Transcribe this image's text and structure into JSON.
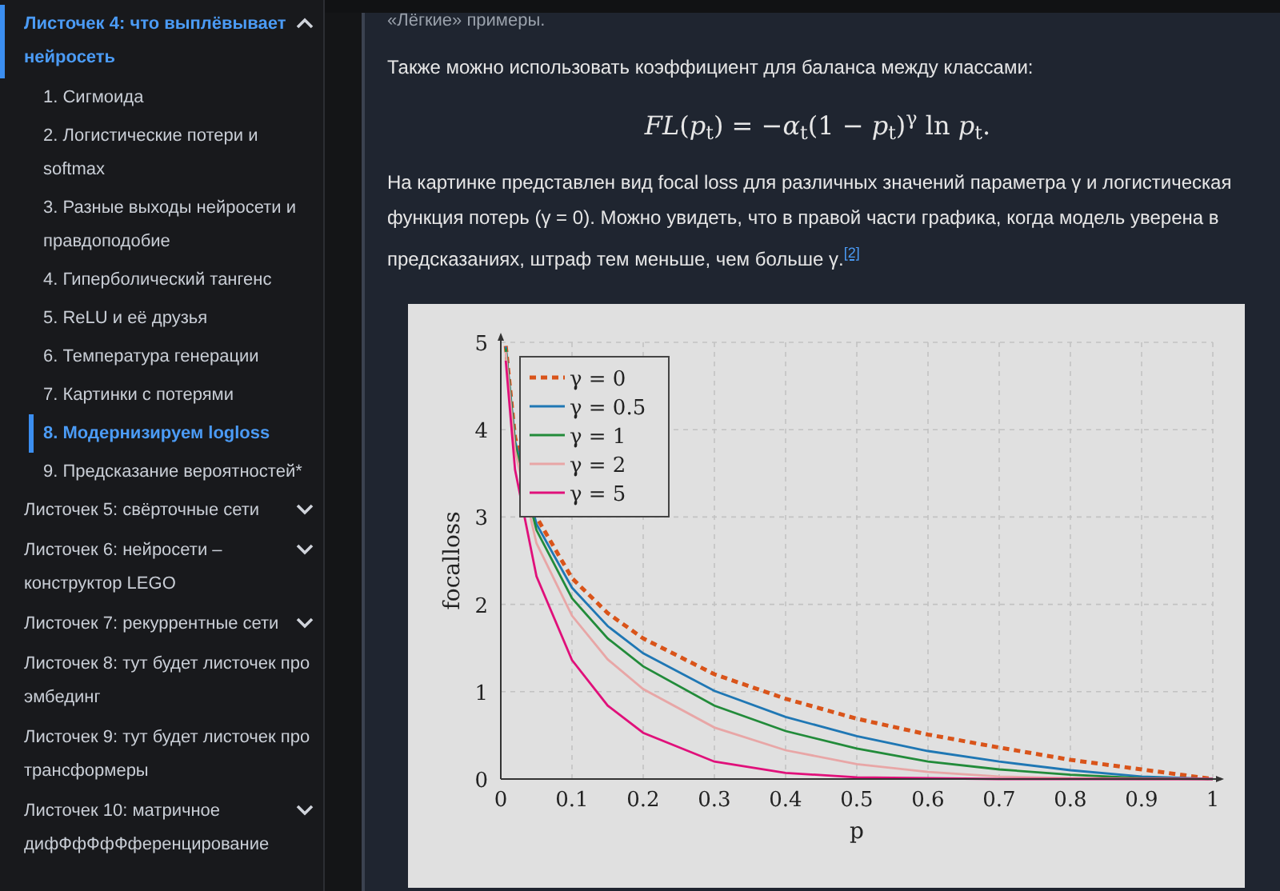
{
  "sidebar": {
    "items": [
      {
        "label": "Листочек 4: что выплёвывает нейросеть",
        "kind": "group",
        "expanded": true,
        "selected": true,
        "children": [
          {
            "label": "1. Сигмоида",
            "selected": false
          },
          {
            "label": "2. Логистические потери и softmax",
            "selected": false
          },
          {
            "label": "3. Разные выходы нейросети и правдоподобие",
            "selected": false
          },
          {
            "label": "4. Гиперболический тангенс",
            "selected": false
          },
          {
            "label": "5. ReLU и её друзья",
            "selected": false
          },
          {
            "label": "6. Температура генерации",
            "selected": false
          },
          {
            "label": "7. Картинки с потерями",
            "selected": false
          },
          {
            "label": "8. Модернизируем logloss",
            "selected": true
          },
          {
            "label": "9. Предсказание вероятностей*",
            "selected": false
          }
        ]
      },
      {
        "label": "Листочек 5: свёрточные сети",
        "kind": "group",
        "expanded": false,
        "selected": false
      },
      {
        "label": "Листочек 6: нейросети – конструктор LEGO",
        "kind": "group",
        "expanded": false,
        "selected": false
      },
      {
        "label": "Листочек 7: рекуррентные сети",
        "kind": "group",
        "expanded": false,
        "selected": false
      },
      {
        "label": "Листочек 8: тут будет листочек про эмбединг",
        "kind": "leaf",
        "selected": false
      },
      {
        "label": "Листочек 9: тут будет листочек про трансформеры",
        "kind": "leaf",
        "selected": false
      },
      {
        "label": "Листочек 10: матричное дифФфФфФференцирование",
        "kind": "group",
        "expanded": false,
        "selected": false
      }
    ]
  },
  "content": {
    "cut_heading": "«Лёгкие» примеры.",
    "paragraph_1": "Также можно использовать коэффициент для баланса между классами:",
    "formula": "*FL*(*p*$_{t}$) = −*α*$_{t}$(1 − *p*$_{t}$)$^{γ}$ ln *p*$_{t}$.",
    "paragraph_2": "На картинке представлен вид focal loss для различных значений параметра γ и логистическая функция потерь (γ = 0). Можно увидеть, что в правой части графика, когда модель уверена в предсказаниях, штраф тем меньше, чем больше γ.",
    "footnote": "[2]",
    "figure": {
      "chart_data": {
        "type": "line",
        "xlabel": "p",
        "ylabel": "focalloss",
        "grid": true,
        "legend": true,
        "x": [
          0.007,
          0.02,
          0.05,
          0.1,
          0.15,
          0.2,
          0.3,
          0.4,
          0.5,
          0.6,
          0.7,
          0.8,
          0.9,
          1
        ],
        "series": [
          {
            "name": "γ = 0",
            "color": "#d9541a",
            "line_style": "dashed",
            "values": [
              4.96,
              3.91,
              3,
              2.3,
              1.9,
              1.61,
              1.2,
              0.92,
              0.69,
              0.51,
              0.36,
              0.22,
              0.11,
              0
            ]
          },
          {
            "name": "γ = 0.5",
            "color": "#1f77b4",
            "line_style": "solid",
            "values": [
              4.95,
              3.87,
              2.92,
              2.19,
              1.75,
              1.44,
              1.01,
              0.71,
              0.49,
              0.32,
              0.2,
              0.1,
              0.03,
              0
            ]
          },
          {
            "name": "γ = 1",
            "color": "#228b3a",
            "line_style": "solid",
            "values": [
              4.93,
              3.83,
              2.85,
              2.07,
              1.61,
              1.29,
              0.84,
              0.55,
              0.35,
              0.2,
              0.11,
              0.05,
              0.01,
              0
            ]
          },
          {
            "name": "γ = 2",
            "color": "#e8a6a6",
            "line_style": "solid",
            "values": [
              4.89,
              3.76,
              2.7,
              1.87,
              1.37,
              1.03,
              0.59,
              0.33,
              0.17,
              0.08,
              0.03,
              0.01,
              0,
              0
            ]
          },
          {
            "name": "γ = 5",
            "color": "#e0107a",
            "line_style": "solid",
            "values": [
              4.79,
              3.54,
              2.32,
              1.36,
              0.84,
              0.53,
              0.2,
              0.07,
              0.02,
              0.01,
              0,
              0,
              0,
              0
            ]
          }
        ],
        "xlim": [
          0,
          1
        ],
        "ylim": [
          0,
          5
        ],
        "xticks": [
          0,
          0.1,
          0.2,
          0.3,
          0.4,
          0.5,
          0.6,
          0.7,
          0.8,
          0.9,
          1
        ],
        "yticks": [
          0,
          1,
          2,
          3,
          4,
          5
        ]
      }
    }
  }
}
